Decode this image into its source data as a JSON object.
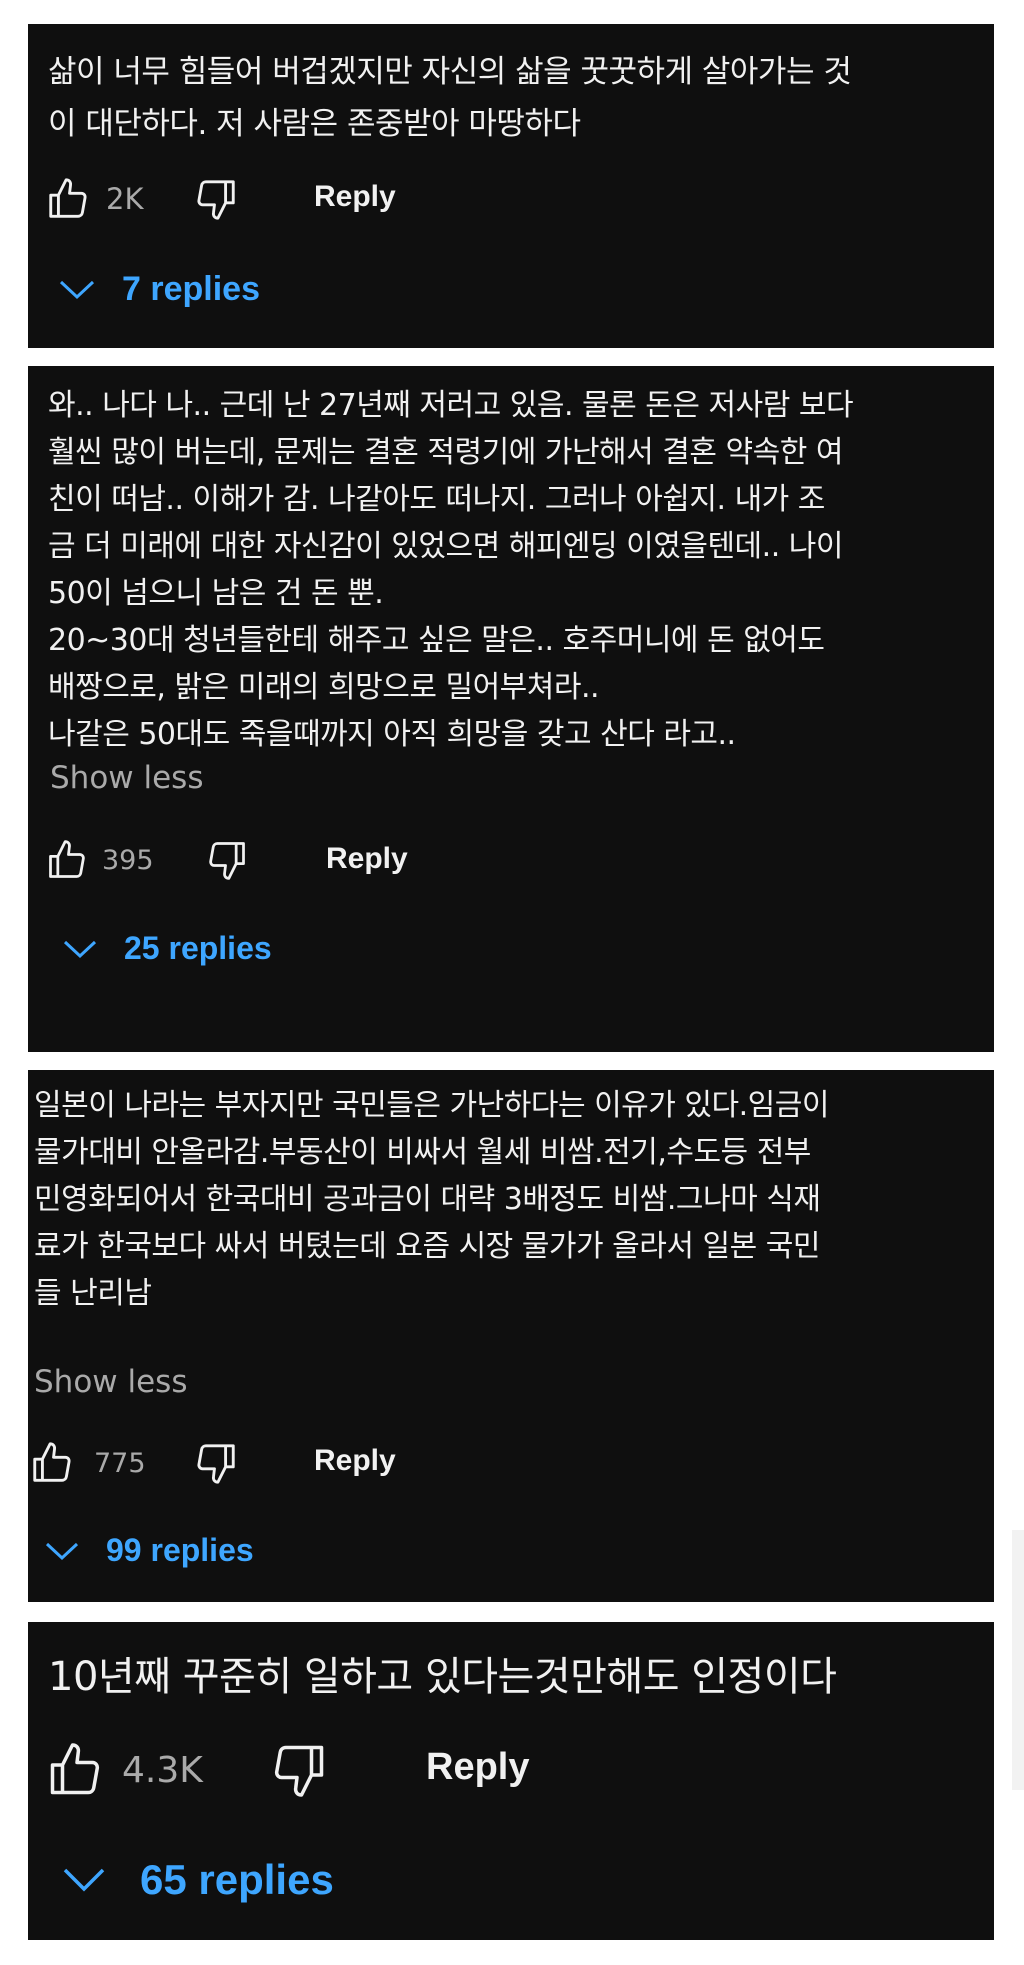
{
  "comments": [
    {
      "lines": [
        "삶이 너무 힘들어 버겁겠지만 자신의 삶을 꿋꿋하게 살아가는 것",
        "이 대단하다. 저 사람은 존중받아 마땅하다"
      ],
      "show_less": "",
      "likes": "2K",
      "reply_label": "Reply",
      "replies_label": "7 replies"
    },
    {
      "lines": [
        "와.. 나다 나.. 근데 난 27년째 저러고 있음. 물론 돈은 저사람 보다",
        "훨씬 많이 버는데, 문제는 결혼 적령기에 가난해서 결혼 약속한 여",
        "친이 떠남.. 이해가 감. 나같아도 떠나지. 그러나 아쉽지. 내가 조",
        "금 더 미래에 대한 자신감이 있었으면 해피엔딩 이였을텐데.. 나이",
        "50이 넘으니 남은 건 돈 뿐.",
        "20~30대 청년들한테 해주고 싶은 말은.. 호주머니에 돈 없어도",
        "배짱으로, 밝은 미래의 희망으로 밀어부쳐라..",
        "나같은 50대도 죽을때까지 아직 희망을 갖고 산다 라고.."
      ],
      "show_less": "Show less",
      "likes": "395",
      "reply_label": "Reply",
      "replies_label": "25 replies"
    },
    {
      "lines": [
        "일본이 나라는 부자지만 국민들은 가난하다는 이유가 있다.임금이",
        "물가대비 안올라감.부동산이 비싸서 월세 비쌈.전기,수도등 전부",
        "민영화되어서 한국대비 공과금이 대략 3배정도 비쌈.그나마 식재",
        "료가 한국보다 싸서 버텼는데 요즘 시장 물가가 올라서 일본 국민",
        "들 난리남"
      ],
      "show_less": "Show less",
      "likes": "775",
      "reply_label": "Reply",
      "replies_label": "99 replies"
    },
    {
      "lines": [
        "10년째 꾸준히 일하고 있다는것만해도 인정이다"
      ],
      "show_less": "",
      "likes": "4.3K",
      "reply_label": "Reply",
      "replies_label": "65 replies"
    }
  ],
  "icons": {
    "like": "thumbs-up-icon",
    "dislike": "thumbs-down-icon",
    "expand": "chevron-down-icon"
  },
  "colors": {
    "card_background": "#0f0f0f",
    "text": "#f1f1f1",
    "secondary_text": "#aaaaaa",
    "replies_link": "#3ea6ff"
  }
}
